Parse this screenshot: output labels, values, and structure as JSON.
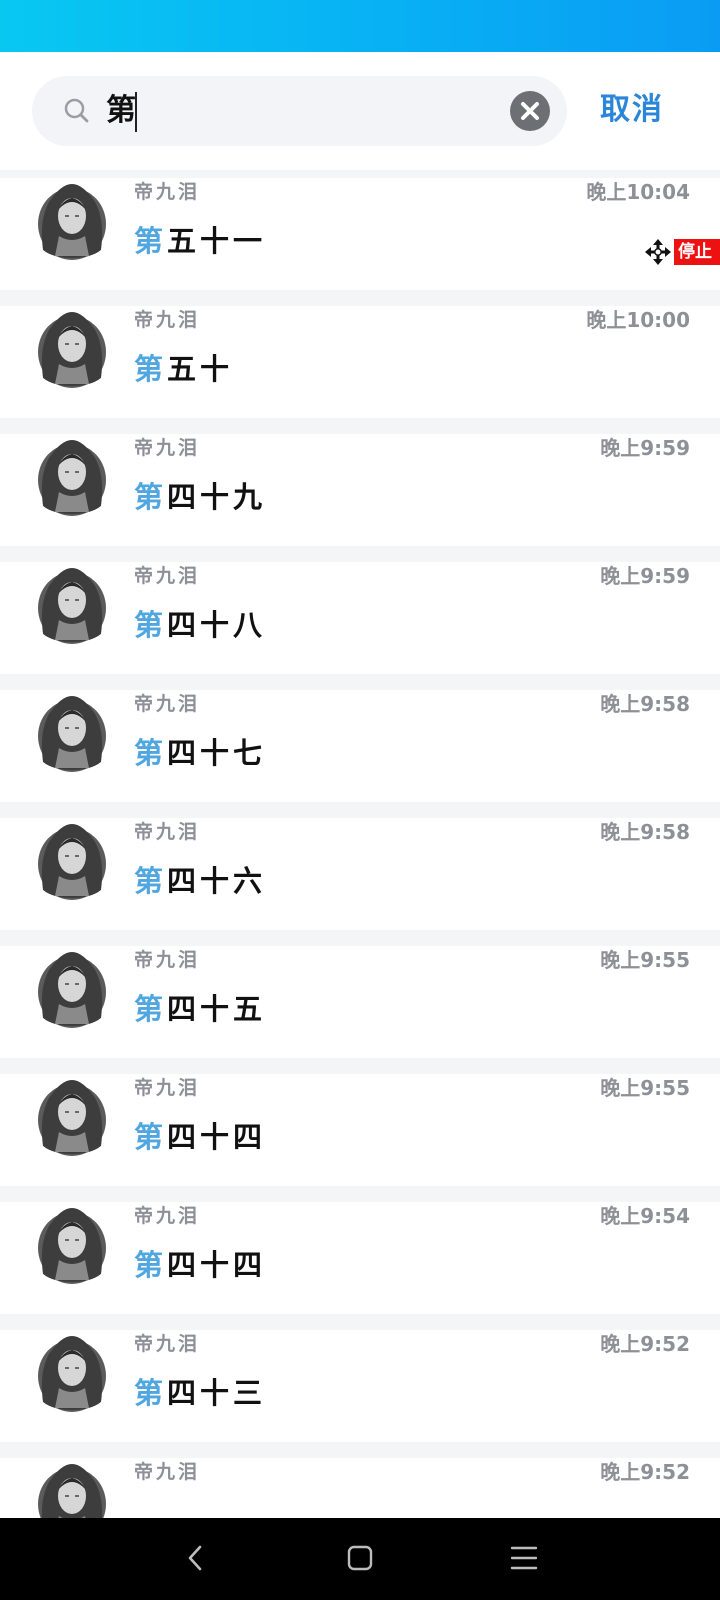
{
  "search": {
    "query": "第",
    "cancel_label": "取消"
  },
  "results": [
    {
      "sender": "帝九泪",
      "time": "晚上10:04",
      "highlight": "第",
      "rest": "五十一"
    },
    {
      "sender": "帝九泪",
      "time": "晚上10:00",
      "highlight": "第",
      "rest": "五十"
    },
    {
      "sender": "帝九泪",
      "time": "晚上9:59",
      "highlight": "第",
      "rest": "四十九"
    },
    {
      "sender": "帝九泪",
      "time": "晚上9:59",
      "highlight": "第",
      "rest": "四十八"
    },
    {
      "sender": "帝九泪",
      "time": "晚上9:58",
      "highlight": "第",
      "rest": "四十七"
    },
    {
      "sender": "帝九泪",
      "time": "晚上9:58",
      "highlight": "第",
      "rest": "四十六"
    },
    {
      "sender": "帝九泪",
      "time": "晚上9:55",
      "highlight": "第",
      "rest": "四十五"
    },
    {
      "sender": "帝九泪",
      "time": "晚上9:55",
      "highlight": "第",
      "rest": "四十四"
    },
    {
      "sender": "帝九泪",
      "time": "晚上9:54",
      "highlight": "第",
      "rest": "四十四"
    },
    {
      "sender": "帝九泪",
      "time": "晚上9:52",
      "highlight": "第",
      "rest": "四十三"
    },
    {
      "sender": "帝九泪",
      "time": "晚上9:52",
      "highlight": "",
      "rest": ""
    }
  ],
  "floating_widget": {
    "stop_label": "停止",
    "icon": "move-icon"
  },
  "nav": {
    "back_icon": "back-icon",
    "home_icon": "home-icon",
    "menu_icon": "menu-icon"
  },
  "colors": {
    "status_bar": "#08b0f4",
    "cancel": "#2a86d8",
    "highlight": "#4fa6e0",
    "stop_badge": "#ee1111"
  }
}
